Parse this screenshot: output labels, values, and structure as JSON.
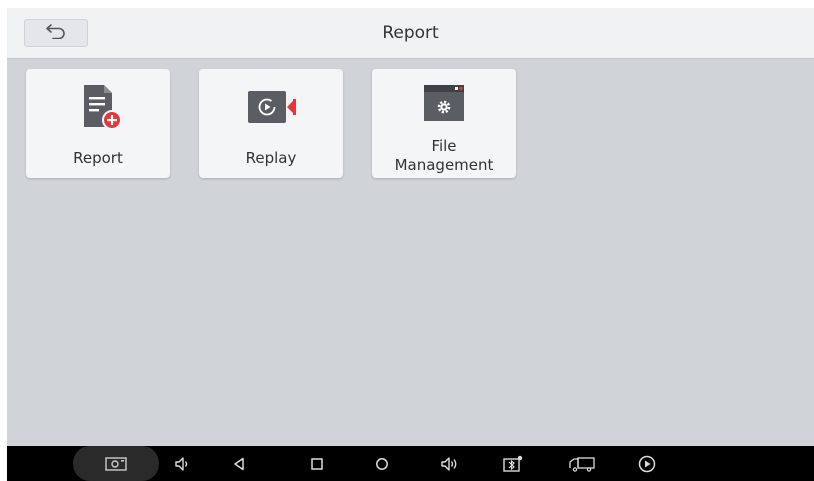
{
  "header": {
    "title": "Report",
    "back_icon": "back-arrow-icon"
  },
  "tiles": [
    {
      "label": "Report",
      "icon": "report-add-icon"
    },
    {
      "label": "Replay",
      "icon": "replay-video-icon"
    },
    {
      "label_line1": "File",
      "label_line2": "Management",
      "icon": "file-settings-icon"
    }
  ],
  "navbar": {
    "items": [
      "screenshot-icon",
      "volume-down-icon",
      "back-icon",
      "recents-icon",
      "home-icon",
      "volume-up-icon",
      "vci-icon",
      "truck-icon",
      "play-icon"
    ]
  },
  "colors": {
    "icon_gray": "#5a5d63",
    "accent_red": "#e0383b",
    "background": "#d0d3d8",
    "titlebar": "#f1f2f4"
  }
}
